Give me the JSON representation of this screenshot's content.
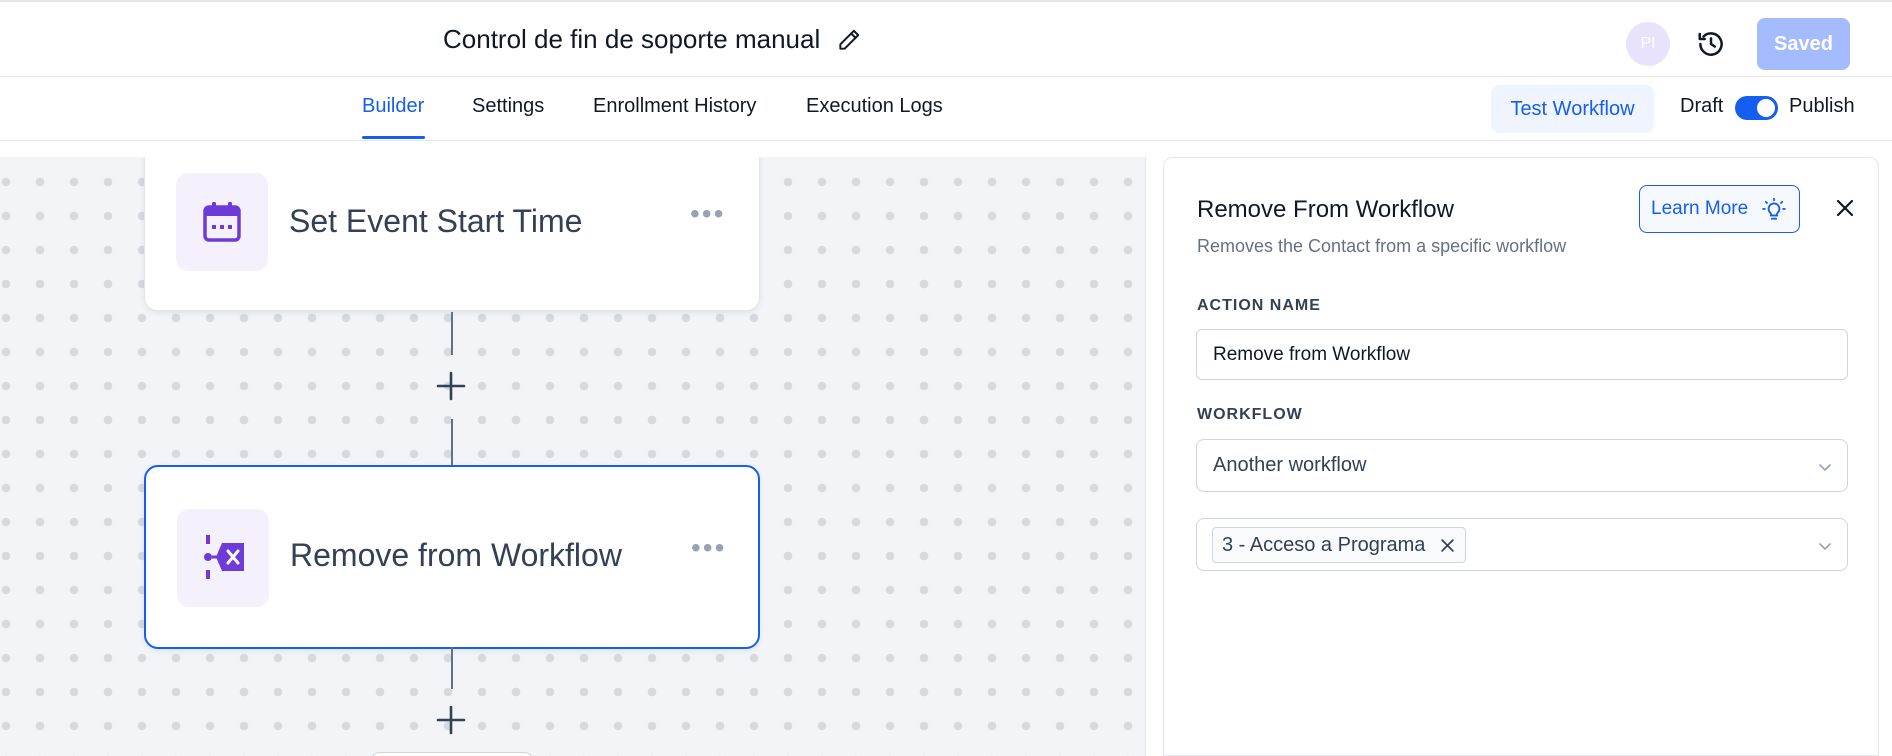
{
  "header": {
    "workflow_title": "Control de fin de soporte manual",
    "avatar_initials": "PI",
    "saved_label": "Saved"
  },
  "tabs": [
    {
      "label": "Builder",
      "active": true
    },
    {
      "label": "Settings",
      "active": false
    },
    {
      "label": "Enrollment History",
      "active": false
    },
    {
      "label": "Execution Logs",
      "active": false
    }
  ],
  "actions": {
    "test_workflow_label": "Test Workflow",
    "draft_label": "Draft",
    "publish_label": "Publish",
    "publish_toggle_on": true
  },
  "canvas": {
    "nodes": [
      {
        "label": "Set Event Start Time",
        "icon": "calendar-icon",
        "selected": false
      },
      {
        "label": "Remove from Workflow",
        "icon": "remove-from-workflow-icon",
        "selected": true
      }
    ],
    "node_menu_glyph": "•••"
  },
  "panel": {
    "title": "Remove From Workflow",
    "subtitle": "Removes the Contact from a specific workflow",
    "learn_more_label": "Learn More",
    "action_name_label": "ACTION NAME",
    "action_name_value": "Remove from Workflow",
    "workflow_label": "WORKFLOW",
    "workflow_select_value": "Another workflow",
    "selected_workflows": [
      "3 - Acceso a Programa"
    ]
  },
  "colors": {
    "primary": "#155eef",
    "saved_button": "#a4bcfd",
    "node_icon": "#6e3bd8",
    "node_icon_bg": "#f4f1fd",
    "canvas_bg": "#f2f4f7"
  }
}
